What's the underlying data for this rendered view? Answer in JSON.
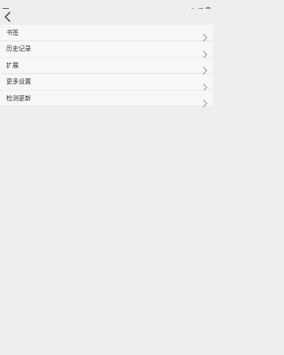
{
  "colors": {
    "background": "#eeeeee",
    "row": "#f7f7f7",
    "icon": "#555555"
  },
  "status_bar": {
    "left_icon": "notification-icon",
    "right_icons": [
      "wifi-icon",
      "sim-icon",
      "battery-icon"
    ]
  },
  "app_bar": {
    "back_icon": "back-arrow-icon"
  },
  "menu": {
    "items": [
      {
        "label": "书签"
      },
      {
        "label": "历史记录"
      },
      {
        "label": "扩展"
      },
      {
        "label": "更多设置"
      },
      {
        "label": "检测更新"
      }
    ]
  }
}
